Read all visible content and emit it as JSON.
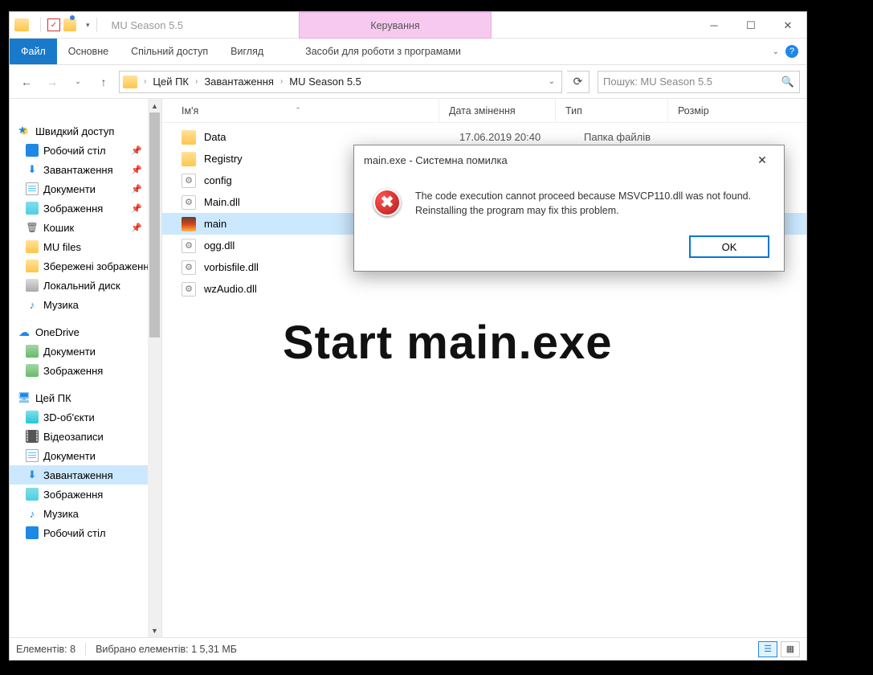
{
  "title": "MU Season 5.5",
  "manage_tab": "Керування",
  "ribbon": {
    "file": "Файл",
    "home": "Основне",
    "share": "Спільний доступ",
    "view": "Вигляд",
    "programs": "Засоби для роботи з програмами"
  },
  "breadcrumb": {
    "root": "Цей ПК",
    "seg1": "Завантаження",
    "seg2": "MU Season 5.5"
  },
  "search_placeholder": "Пошук: MU Season 5.5",
  "sidebar": {
    "quick": "Швидкий доступ",
    "desktop": "Робочий стіл",
    "downloads": "Завантаження",
    "documents": "Документи",
    "pictures": "Зображення",
    "recycle": "Кошик",
    "mufiles": "MU files",
    "saved": "Збережені зображення",
    "localdisk": "Локальний диск",
    "music": "Музика",
    "onedrive": "OneDrive",
    "od_docs": "Документи",
    "od_pics": "Зображення",
    "thispc": "Цей ПК",
    "objects3d": "3D-об'єкти",
    "videos": "Відеозаписи",
    "pc_docs": "Документи",
    "pc_downloads": "Завантаження",
    "pc_pics": "Зображення",
    "pc_music": "Музика",
    "pc_desktop": "Робочий стіл"
  },
  "columns": {
    "name": "Ім'я",
    "date": "Дата змінення",
    "type": "Тип",
    "size": "Розмір"
  },
  "files": [
    {
      "name": "Data",
      "icon": "folder",
      "date": "17.06.2019 20:40",
      "type": "Папка файлів"
    },
    {
      "name": "Registry",
      "icon": "folder",
      "date": "",
      "type": ""
    },
    {
      "name": "config",
      "icon": "gear",
      "date": "",
      "type": ""
    },
    {
      "name": "Main.dll",
      "icon": "gear",
      "date": "",
      "type": ""
    },
    {
      "name": "main",
      "icon": "main",
      "date": "",
      "type": "",
      "selected": true
    },
    {
      "name": "ogg.dll",
      "icon": "gear",
      "date": "",
      "type": ""
    },
    {
      "name": "vorbisfile.dll",
      "icon": "gear",
      "date": "",
      "type": ""
    },
    {
      "name": "wzAudio.dll",
      "icon": "gear",
      "date": "",
      "type": ""
    }
  ],
  "overlay_text": "Start main.exe",
  "statusbar": {
    "count": "Елементів: 8",
    "selection": "Вибрано елементів: 1  5,31 МБ"
  },
  "dialog": {
    "title": "main.exe - Системна помилка",
    "message": "The code execution cannot proceed because MSVCP110.dll was not found. Reinstalling the program may fix this problem.",
    "ok": "OK"
  }
}
